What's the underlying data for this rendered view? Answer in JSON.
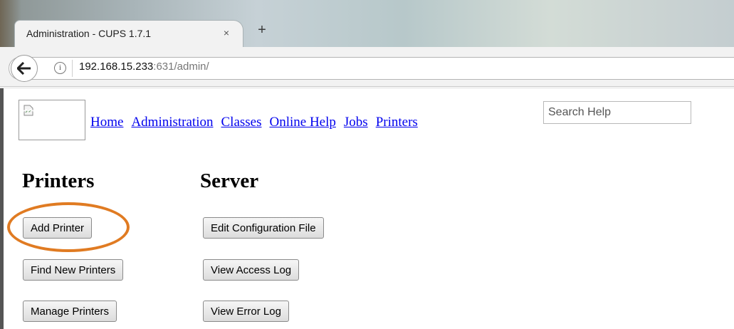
{
  "browser": {
    "tab_title": "Administration - CUPS 1.7.1",
    "tab_close": "×",
    "new_tab": "+",
    "url_host": "192.168.15.233",
    "url_rest": ":631/admin/",
    "info_glyph": "i"
  },
  "nav": {
    "links": [
      "Home",
      "Administration",
      "Classes",
      "Online Help",
      "Jobs",
      "Printers"
    ],
    "search_placeholder": "Search Help"
  },
  "sections": {
    "printers": {
      "heading": "Printers",
      "buttons": [
        "Add Printer",
        "Find New Printers",
        "Manage Printers"
      ]
    },
    "server": {
      "heading": "Server",
      "buttons": [
        "Edit Configuration File",
        "View Access Log",
        "View Error Log"
      ]
    }
  },
  "colors": {
    "link": "#0000ee",
    "highlight": "#e07b22"
  },
  "icons": {
    "back": "back-arrow-icon",
    "info": "info-icon",
    "logo": "broken-image-icon"
  }
}
